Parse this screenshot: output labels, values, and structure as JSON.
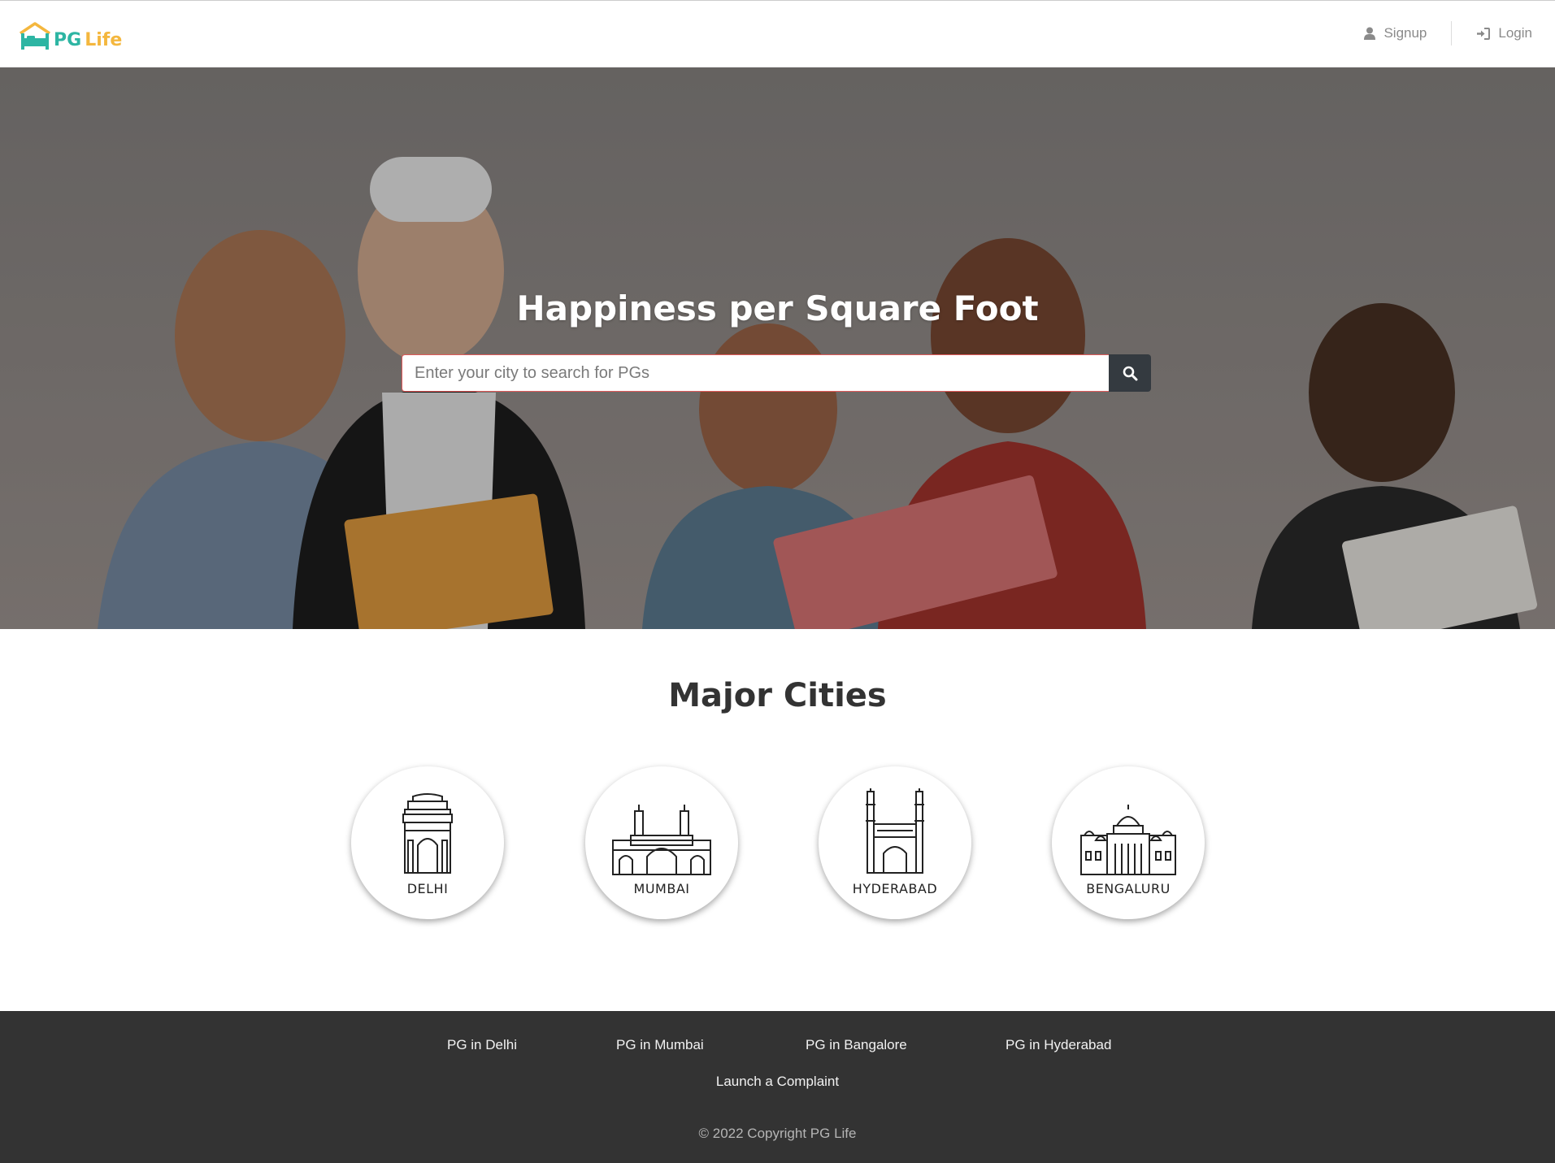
{
  "navbar": {
    "brand_pg": "PG",
    "brand_life": "Life",
    "signup_label": "Signup",
    "login_label": "Login"
  },
  "hero": {
    "title": "Happiness per Square Foot",
    "search_placeholder": "Enter your city to search for PGs",
    "search_value": ""
  },
  "cities": {
    "title": "Major Cities",
    "items": [
      {
        "label": "DELHI",
        "icon": "india-gate-icon"
      },
      {
        "label": "MUMBAI",
        "icon": "gateway-of-india-icon"
      },
      {
        "label": "HYDERABAD",
        "icon": "charminar-icon"
      },
      {
        "label": "BENGALURU",
        "icon": "vidhana-soudha-icon"
      }
    ]
  },
  "footer": {
    "links": [
      "PG in Delhi",
      "PG in Mumbai",
      "PG in Bangalore",
      "PG in Hyderabad"
    ],
    "complaint": "Launch a Complaint",
    "copyright": "© 2022 Copyright PG Life"
  },
  "colors": {
    "brand_teal": "#2db5a3",
    "brand_yellow": "#f4b73e",
    "footer_bg": "#333333",
    "search_button": "#343a40"
  }
}
